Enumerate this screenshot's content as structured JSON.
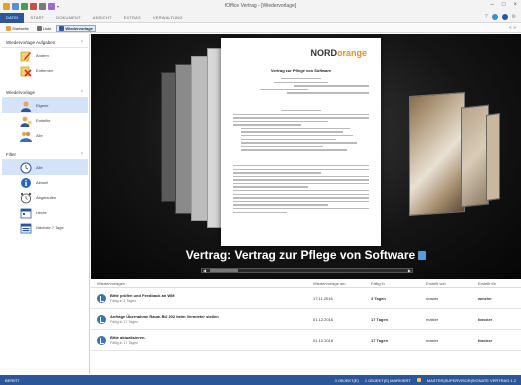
{
  "window": {
    "title": "fOffice Vertrag - [Wiedervorlage]",
    "controls": [
      "–",
      "□",
      "×"
    ]
  },
  "ribbon": {
    "tabs": [
      "DATEI",
      "START",
      "DOKUMENT",
      "ANSICHT",
      "EXTRAS",
      "VERWALTUNG"
    ],
    "active_tab": "DATEI",
    "right_icons": [
      "help-icon",
      "globe-icon",
      "user-icon",
      "settings-icon"
    ]
  },
  "toolbar": {
    "buttons": [
      {
        "label": "Startseite",
        "icon": "home-icon"
      },
      {
        "label": "Liste",
        "icon": "list-icon"
      },
      {
        "label": "Wiedervorlage",
        "icon": "calendar-icon"
      }
    ],
    "right_text": "« »"
  },
  "sidebar": {
    "panels": [
      {
        "title": "Wiedervorlage Aufgaben",
        "items": [
          {
            "label": "Ändern",
            "icon": "edit-icon"
          },
          {
            "label": "Entfernen",
            "icon": "delete-icon"
          }
        ]
      },
      {
        "title": "Wiedervorlage",
        "items": [
          {
            "label": "Eigene",
            "icon": "user-icon",
            "selected": true
          },
          {
            "label": "Erstellte",
            "icon": "user-edit-icon"
          },
          {
            "label": "Alle",
            "icon": "users-icon"
          }
        ]
      },
      {
        "title": "Filter",
        "items": [
          {
            "label": "Alle",
            "icon": "clock-icon",
            "selected": true
          },
          {
            "label": "Aktuell",
            "icon": "info-icon"
          },
          {
            "label": "Abgelaufen",
            "icon": "alarm-icon"
          },
          {
            "label": "Heute",
            "icon": "calendar-today-icon"
          },
          {
            "label": "Nächste 7 Tage",
            "icon": "calendar-week-icon"
          }
        ]
      }
    ]
  },
  "viewer": {
    "caption": "Vertrag: Vertrag zur Pflege von Software",
    "document": {
      "logo_prefix": "NORD",
      "logo_suffix": "orange",
      "title": "Vertrag zur Pflege von Software"
    }
  },
  "grid": {
    "columns": [
      "Wiedervorlagen",
      "Wiedervorlage am",
      "Fällig in",
      "Erstellt von",
      "Erstellt für"
    ],
    "rows": [
      {
        "title": "Bitte prüfen und Feedback an WM",
        "sub": "Fällig in 3 Tagen",
        "date": "17.11.2016",
        "due": "3 Tagen",
        "creator": "master",
        "for": "wmeier"
      },
      {
        "title": "Anfrage Übernahme Raum BU 202 beim Vermieter stellen",
        "sub": "Fällig in 17 Tagen",
        "date": "01.12.2016",
        "due": "17 Tagen",
        "creator": "master",
        "for": "tbecker"
      },
      {
        "title": "Bitte aktualisieren.",
        "sub": "Fällig in 17 Tagen",
        "date": "01.12.2016",
        "due": "17 Tagen",
        "creator": "master",
        "for": "tbecker"
      }
    ]
  },
  "status": {
    "left": "BEREIT",
    "items": [
      "3 OBJEKT(E)",
      "1 OBJEKT(E) MARKIERT",
      "MASTER|SUPERVISOR|SIGNATE VERTRAG 1.2"
    ]
  },
  "colors": {
    "accent": "#2b579a",
    "logo_orange": "#f28c1d",
    "selection": "#d4e3f8"
  }
}
